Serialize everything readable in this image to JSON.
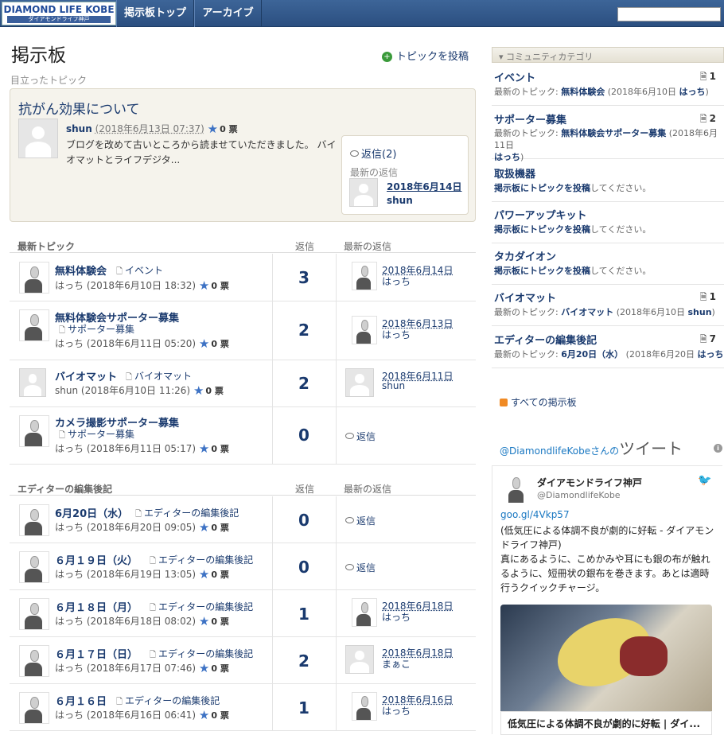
{
  "header": {
    "logo_main": "DIAMOND LIFE KOBE",
    "logo_sub": "ダイアモンドライフ神戸",
    "nav": [
      "掲示板トップ",
      "アーカイブ"
    ],
    "search_value": ""
  },
  "main": {
    "title": "掲示板",
    "post_topic": "トピックを投稿",
    "featured_label": "目立ったトピック",
    "featured": {
      "title": "抗がん効果について",
      "user": "shun",
      "date": "(2018年6月13日 07:37)",
      "votes": "0 票",
      "excerpt": "ブログを改めて古いところから読ませていただきました。 バイオマットとライフデジタ...",
      "reply_count": "返信(2)",
      "latest_reply_label": "最新の返信",
      "reply_date": "2018年6月14日",
      "reply_user": "shun"
    },
    "latest_section": {
      "head": "最新トピック",
      "col_replies": "返信",
      "col_latest": "最新の返信",
      "rows": [
        {
          "title": "無料体験会",
          "cat": "イベント",
          "user": "はっち",
          "date": "(2018年6月10日 18:32)",
          "votes": "0 票",
          "count": "3",
          "last_date": "2018年6月14日",
          "last_user": "はっち"
        },
        {
          "title": "無料体験会サポーター募集",
          "cat": "サポーター募集",
          "user": "はっち",
          "date": "(2018年6月11日 05:20)",
          "votes": "0 票",
          "count": "2",
          "last_date": "2018年6月13日",
          "last_user": "はっち"
        },
        {
          "title": "バイオマット",
          "cat": "バイオマット",
          "user": "shun",
          "date": "(2018年6月10日 11:26)",
          "votes": "0 票",
          "count": "2",
          "last_date": "2018年6月11日",
          "last_user": "shun"
        },
        {
          "title": "カメラ撮影サポーター募集",
          "cat": "サポーター募集",
          "user": "はっち",
          "date": "(2018年6月11日 05:17)",
          "votes": "0 票",
          "count": "0",
          "no_reply": "返信"
        }
      ]
    },
    "editor_section": {
      "head": "エディターの編集後記",
      "col_replies": "返信",
      "col_latest": "最新の返信",
      "rows": [
        {
          "title": "6月20日（水）",
          "cat": "エディターの編集後記",
          "user": "はっち",
          "date": "(2018年6月20日 09:05)",
          "votes": "0 票",
          "count": "0",
          "no_reply": "返信"
        },
        {
          "title": "６月１９日（火）",
          "cat": "エディターの編集後記",
          "user": "はっち",
          "date": "(2018年6月19日 13:05)",
          "votes": "0 票",
          "count": "0",
          "no_reply": "返信"
        },
        {
          "title": "６月１８日（月）",
          "cat": "エディターの編集後記",
          "user": "はっち",
          "date": "(2018年6月18日 08:02)",
          "votes": "0 票",
          "count": "1",
          "last_date": "2018年6月18日",
          "last_user": "はっち"
        },
        {
          "title": "６月１７日（日）",
          "cat": "エディターの編集後記",
          "user": "はっち",
          "date": "(2018年6月17日 07:46)",
          "votes": "0 票",
          "count": "2",
          "last_date": "2018年6月18日",
          "last_user": "まぁこ"
        },
        {
          "title": "６月１６日",
          "cat": "エディターの編集後記",
          "user": "はっち",
          "date": "(2018年6月16日 06:41)",
          "votes": "0 票",
          "count": "1",
          "last_date": "2018年6月16日",
          "last_user": "はっち"
        }
      ]
    }
  },
  "sidebar": {
    "category_head": "▾ コミュニティカテゴリ",
    "categories": [
      {
        "name": "イベント",
        "count": "1",
        "last_prefix": "最新のトピック: ",
        "last_topic": "無料体験会",
        "last_date": " (2018年6月10日 ",
        "last_user": "はっち",
        "suffix": ")"
      },
      {
        "name": "サポーター募集",
        "count": "2",
        "last_prefix": "最新のトピック: ",
        "last_topic": "無料体験会サポーター募集",
        "last_date": " (2018年6月11日",
        "last_user": "はっち",
        "suffix": ")"
      },
      {
        "name": "取扱機器",
        "empty": "掲示板にトピックを投稿",
        "empty_tail": "してください。"
      },
      {
        "name": "パワーアップキット",
        "empty": "掲示板にトピックを投稿",
        "empty_tail": "してください。"
      },
      {
        "name": "タカダイオン",
        "empty": "掲示板にトピックを投稿",
        "empty_tail": "してください。"
      },
      {
        "name": "バイオマット",
        "count": "1",
        "last_prefix": "最新のトピック: ",
        "last_topic": "バイオマット",
        "last_date": " (2018年6月10日 ",
        "last_user": "shun",
        "suffix": ")"
      },
      {
        "name": "エディターの編集後記",
        "count": "7",
        "last_prefix": "最新のトピック: ",
        "last_topic": "6月20日（水）",
        "last_date": " (2018年6月20日 ",
        "last_user": "はっち",
        "suffix": ")"
      }
    ],
    "all_boards": "すべての掲示板",
    "twitter": {
      "handle_prefix": "@DiamondlifeKobe",
      "handle_suffix": "さんの",
      "big": "ツイート",
      "name": "ダイアモンドライフ神戸",
      "handle": "@DiamondlifeKobe",
      "link": "goo.gl/4Vkp57",
      "text": "(低気圧による体調不良が劇的に好転 - ダイアモンドライフ神戸)\n真にあるように、こめかみや耳にも銀の布が触れるように、短冊状の銀布を巻きます。あとは適時行うクイックチャージ。",
      "caption": "低気圧による体調不良が劇的に好転 | ダイ..."
    }
  }
}
